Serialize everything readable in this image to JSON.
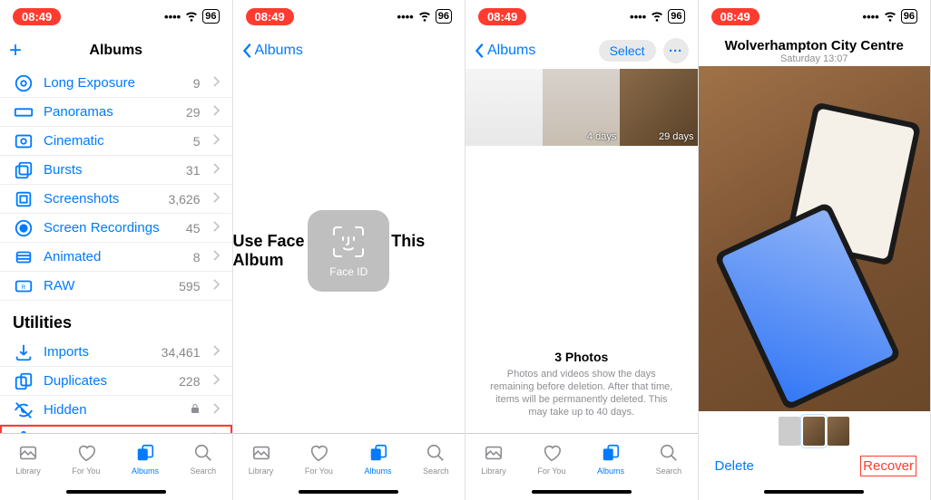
{
  "status": {
    "time": "08:49",
    "battery": "96"
  },
  "screen1": {
    "title": "Albums",
    "media_rows": [
      {
        "key": "long-exposure",
        "label": "Long Exposure",
        "count": "9"
      },
      {
        "key": "panoramas",
        "label": "Panoramas",
        "count": "29"
      },
      {
        "key": "cinematic",
        "label": "Cinematic",
        "count": "5"
      },
      {
        "key": "bursts",
        "label": "Bursts",
        "count": "31"
      },
      {
        "key": "screenshots",
        "label": "Screenshots",
        "count": "3,626"
      },
      {
        "key": "screen-recordings",
        "label": "Screen Recordings",
        "count": "45"
      },
      {
        "key": "animated",
        "label": "Animated",
        "count": "8"
      },
      {
        "key": "raw",
        "label": "RAW",
        "count": "595"
      }
    ],
    "utilities_header": "Utilities",
    "utility_rows": [
      {
        "key": "imports",
        "label": "Imports",
        "count": "34,461",
        "lock": false,
        "highlight": false
      },
      {
        "key": "duplicates",
        "label": "Duplicates",
        "count": "228",
        "lock": false,
        "highlight": false
      },
      {
        "key": "hidden",
        "label": "Hidden",
        "count": "",
        "lock": true,
        "highlight": false
      },
      {
        "key": "recently-deleted",
        "label": "Recently Deleted",
        "count": "",
        "lock": true,
        "highlight": true
      }
    ]
  },
  "screen2": {
    "back": "Albums",
    "message": "Use Face ID to View This Album",
    "faceid_label": "Face ID"
  },
  "screen3": {
    "back": "Albums",
    "select": "Select",
    "thumbs": [
      {
        "key": "t1",
        "badge": ""
      },
      {
        "key": "t2",
        "badge": "4 days"
      },
      {
        "key": "t3",
        "badge": "29 days"
      }
    ],
    "info_title": "3 Photos",
    "info_sub": "Photos and videos show the days remaining before deletion. After that time, items will be permanently deleted. This may take up to 40 days."
  },
  "screen4": {
    "title": "Wolverhampton City Centre",
    "subtitle": "Saturday 13:07",
    "delete": "Delete",
    "recover": "Recover"
  },
  "tabs": [
    {
      "key": "library",
      "label": "Library"
    },
    {
      "key": "for-you",
      "label": "For You"
    },
    {
      "key": "albums",
      "label": "Albums"
    },
    {
      "key": "search",
      "label": "Search"
    }
  ]
}
